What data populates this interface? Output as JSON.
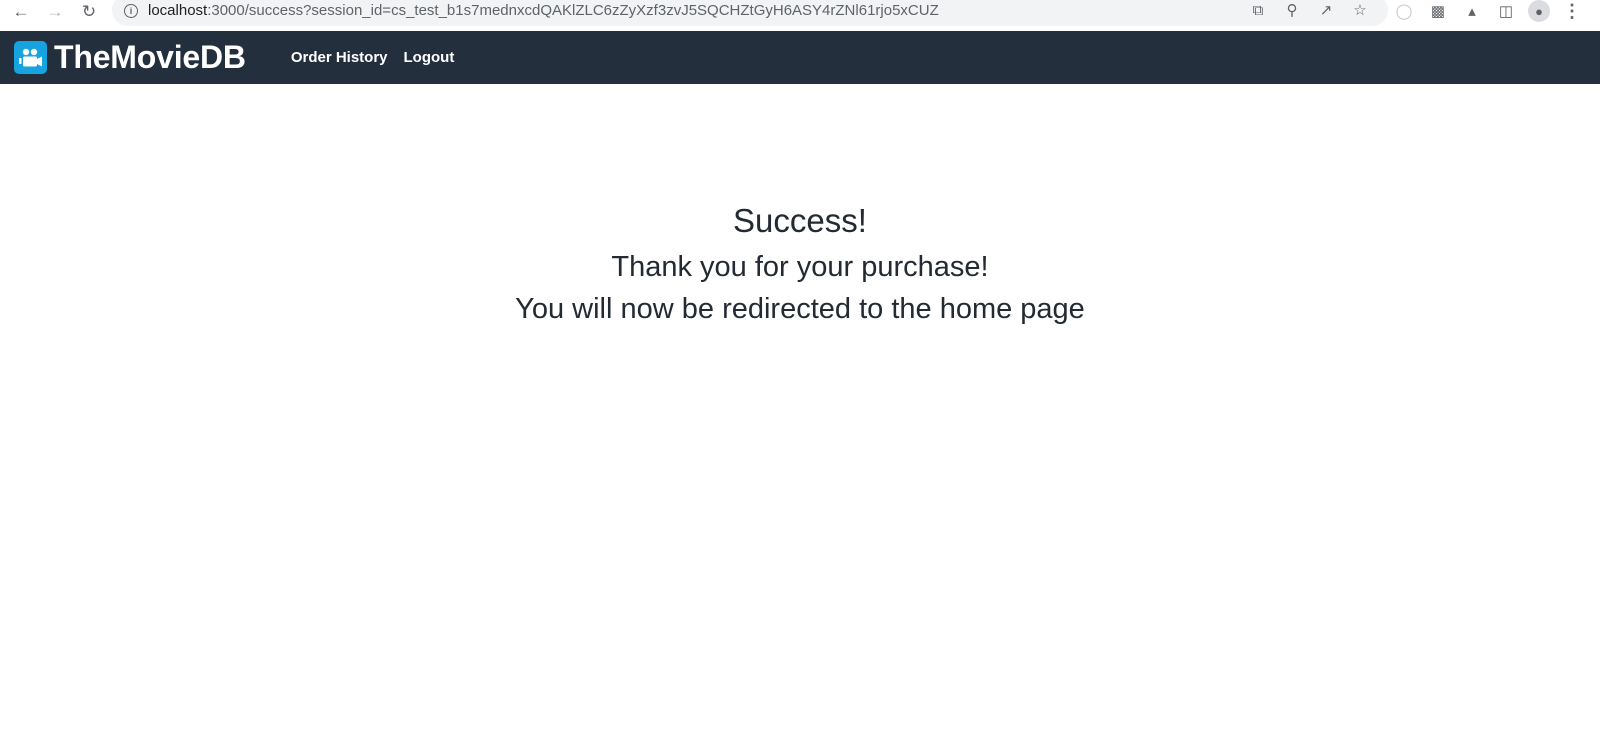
{
  "browser": {
    "url_host": "localhost",
    "url_rest": ":3000/success?session_id=cs_test_b1s7mednxcdQAKlZLC6zZyXzf3zvJ5SQCHZtGyH6ASY4rZNl61rjo5xCUZ",
    "nav_icons": [
      "back-arrow-icon",
      "forward-arrow-icon",
      "reload-icon"
    ],
    "omnibox_icons": [
      "open-external-icon",
      "zoom-icon",
      "share-icon",
      "star-icon"
    ],
    "toolbar_icons": [
      "extension-icon",
      "puzzle-icon",
      "labs-flask-icon",
      "side-panel-icon",
      "profile-avatar-icon",
      "more-menu-icon"
    ]
  },
  "navbar": {
    "brand": "TheMovieDB",
    "brand_color": "#16a3e0",
    "background": "#242f3e",
    "links": [
      {
        "label": "Order History"
      },
      {
        "label": "Logout"
      }
    ]
  },
  "message": {
    "title": "Success!",
    "line1": "Thank you for your purchase!",
    "line2": "You will now be redirected to the home page"
  }
}
